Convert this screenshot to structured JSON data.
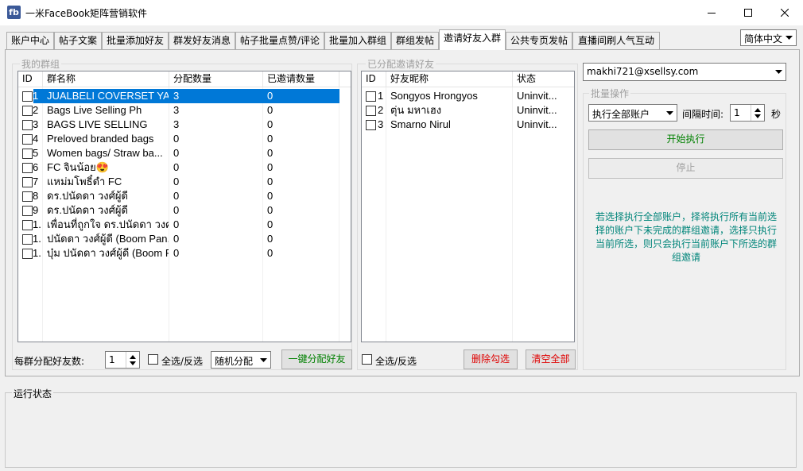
{
  "window": {
    "app_icon": "fb",
    "title": "一米FaceBook矩阵营销软件"
  },
  "tabs": [
    {
      "label": "账户中心"
    },
    {
      "label": "帖子文案"
    },
    {
      "label": "批量添加好友"
    },
    {
      "label": "群发好友消息"
    },
    {
      "label": "帖子批量点赞/评论"
    },
    {
      "label": "批量加入群组"
    },
    {
      "label": "群组发帖"
    },
    {
      "label": "邀请好友入群"
    },
    {
      "label": "公共专页发帖"
    },
    {
      "label": "直播间刷人气互动"
    }
  ],
  "active_tab": "邀请好友入群",
  "language": {
    "selected": "简体中文"
  },
  "my_groups": {
    "legend": "我的群组",
    "columns": [
      "ID",
      "群名称",
      "分配数量",
      "已邀请数量"
    ],
    "rows": [
      {
        "id": "1",
        "name": "JUALBELI COVERSET YA...",
        "assigned": "3",
        "invited": "0",
        "selected": true
      },
      {
        "id": "2",
        "name": "Bags Live Selling Ph",
        "assigned": "3",
        "invited": "0"
      },
      {
        "id": "3",
        "name": "BAGS LIVE SELLING",
        "assigned": "3",
        "invited": "0"
      },
      {
        "id": "4",
        "name": "Preloved branded bags",
        "assigned": "0",
        "invited": "0"
      },
      {
        "id": "5",
        "name": "Women bags/ Straw ba...",
        "assigned": "0",
        "invited": "0"
      },
      {
        "id": "6",
        "name": "FC จินน้อย😍",
        "assigned": "0",
        "invited": "0"
      },
      {
        "id": "7",
        "name": "แหม่มโพธิ์ดำ FC",
        "assigned": "0",
        "invited": "0"
      },
      {
        "id": "8",
        "name": "ดร.ปนัดดา วงศ์ผู้ดี",
        "assigned": "0",
        "invited": "0"
      },
      {
        "id": "9",
        "name": "ดร.ปนัดดา วงศ์ผู้ดี",
        "assigned": "0",
        "invited": "0"
      },
      {
        "id": "1.",
        "name": "เพื่อนที่ถูกใจ ดร.ปนัดดา วงศ์ผู้ดี",
        "assigned": "0",
        "invited": "0"
      },
      {
        "id": "1.",
        "name": "ปนัดดา วงศ์ผู้ดี (Boom Pan...",
        "assigned": "0",
        "invited": "0"
      },
      {
        "id": "1.",
        "name": "บุ๋ม ปนัดดา วงศ์ผู้ดี (Boom P...",
        "assigned": "0",
        "invited": "0"
      }
    ]
  },
  "assigned_friends": {
    "legend": "已分配邀请好友",
    "columns": [
      "ID",
      "好友昵称",
      "状态"
    ],
    "rows": [
      {
        "id": "1",
        "name": "Songyos Hrongyos",
        "status": "Uninvit..."
      },
      {
        "id": "2",
        "name": "ตุ่น มหาเฮง",
        "status": "Uninvit..."
      },
      {
        "id": "3",
        "name": "Smarno Nirul",
        "status": "Uninvit..."
      }
    ]
  },
  "bottom_controls": {
    "per_group_label": "每群分配好友数:",
    "per_group_value": "1",
    "select_all_left": "全选/反选",
    "distribution_mode": "随机分配",
    "one_click_assign": "一键分配好友",
    "select_all_right": "全选/反选",
    "delete_checked": "删除勾选",
    "clear_all": "清空全部"
  },
  "right_panel": {
    "account": "makhi721@xsellsy.com",
    "batch_legend": "批量操作",
    "run_mode": "执行全部账户",
    "interval_label": "间隔时间:",
    "interval_value": "1",
    "interval_unit": "秒",
    "start_button": "开始执行",
    "stop_button": "停止",
    "info_text": "若选择执行全部账户，择将执行所有当前选择的账户下未完成的群组邀请，选择只执行当前所选，则只会执行当前账户下所选的群组邀请"
  },
  "status_panel": {
    "legend": "运行状态"
  },
  "colors": {
    "selection": "#0078d7",
    "start_text": "#008000",
    "one_click_text": "#008000",
    "danger_text": "#e00000",
    "info_text": "#00857a"
  }
}
